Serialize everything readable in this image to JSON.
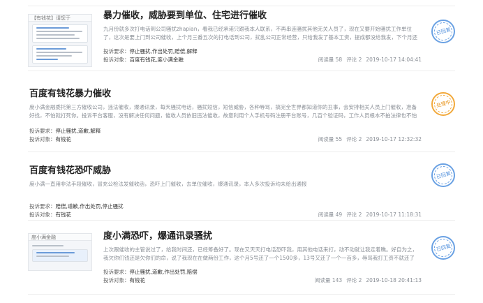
{
  "complaints": [
    {
      "title": "暴力催收，威胁要到单位、住宅进行催收",
      "summary": "九月份就多次打电话到公司骚扰zhapian，看我已经承诺只跟我本人联系，不再串连骚扰其他无关人员了，现在又要开始骚扰工作单位了，这次是要上门到公司催收，上个月三番五次的打电话到公司，扰乱公司正常经营，只给我发了基本工资，提成都没给我发，下个月还要被安...",
      "demand_label": "投诉要求：",
      "demand": "停止骚扰,作出处罚,赔偿,解释",
      "target_label": "投诉对象：",
      "target": "百度有钱花,度小满金融",
      "views": "阅读量 58",
      "comments": "评论 2",
      "date": "2019-10-17 14:04:41",
      "status": "已回复",
      "thumb": {
        "caption": "【有钱花】请您于"
      }
    },
    {
      "title": "百度有钱花暴力催收",
      "summary": "度小满金融委托第三方催收公司，违法催收，爆通讯录，每天骚扰电话，骚扰短信，短信威胁，各种辱骂，搞完全世界都知道你的丑事，会安排相关人员上门催收，准备好找，不怕就打死你。投诉平台客服，没有解决任何问题，催收人员依旧违法催收，故意利用个人手机号码注册平台账号，几百个验证码，工作人员根本不拍法律也不怕误...",
      "demand_label": "投诉要求：",
      "demand": "停止骚扰,道歉,解释",
      "target_label": "投诉对象：",
      "target": "有钱花",
      "views": "阅读量 55",
      "comments": "评论 2",
      "date": "2019-10-17 12:32:32",
      "status": "处理中"
    },
    {
      "title": "百度有钱花恐吓威胁",
      "summary": "度小满一直用非法手段催收，冒充公检法发催收函，恐吓上门催收，去单位催收，爆通讯录，本人多次投诉均未给出通报",
      "demand_label": "投诉要求：",
      "demand": "赔偿,道歉,作出处罚,停止骚扰",
      "target_label": "投诉对象：",
      "target": "有钱花",
      "views": "阅读量 49",
      "comments": "评论 2",
      "date": "2019-10-17 11:18:31",
      "status": "已回复"
    },
    {
      "title": "度小满恐吓，爆通讯录骚扰",
      "summary": "上次跟催收的主管说过了，给我时间还，已经筹备好了。现在又天天打电话恐吓我，用其他电话来打，动不动就让我走着瞧。好自为之，我欠你们钱还是欠你们的命，说了我现在在做两份工作，这个月5号还了一个1500多，13号又还了一个一百多，辱骂我打工资不就还了吗，为什么...",
      "demand_label": "投诉要求：",
      "demand": "停止骚扰,道歉,作出处罚,赔偿",
      "target_label": "投诉对象：",
      "target": "有钱花",
      "views": "阅读量 143",
      "comments": "评论 2",
      "date": "2019-10-18 20:41:13",
      "status": "已回复",
      "thumb": {
        "caption": "度小满金融"
      }
    }
  ],
  "colors": {
    "replied": "#6aa1e3",
    "processing": "#f2a93b",
    "title": "#222222",
    "muted": "#8a8f96"
  }
}
